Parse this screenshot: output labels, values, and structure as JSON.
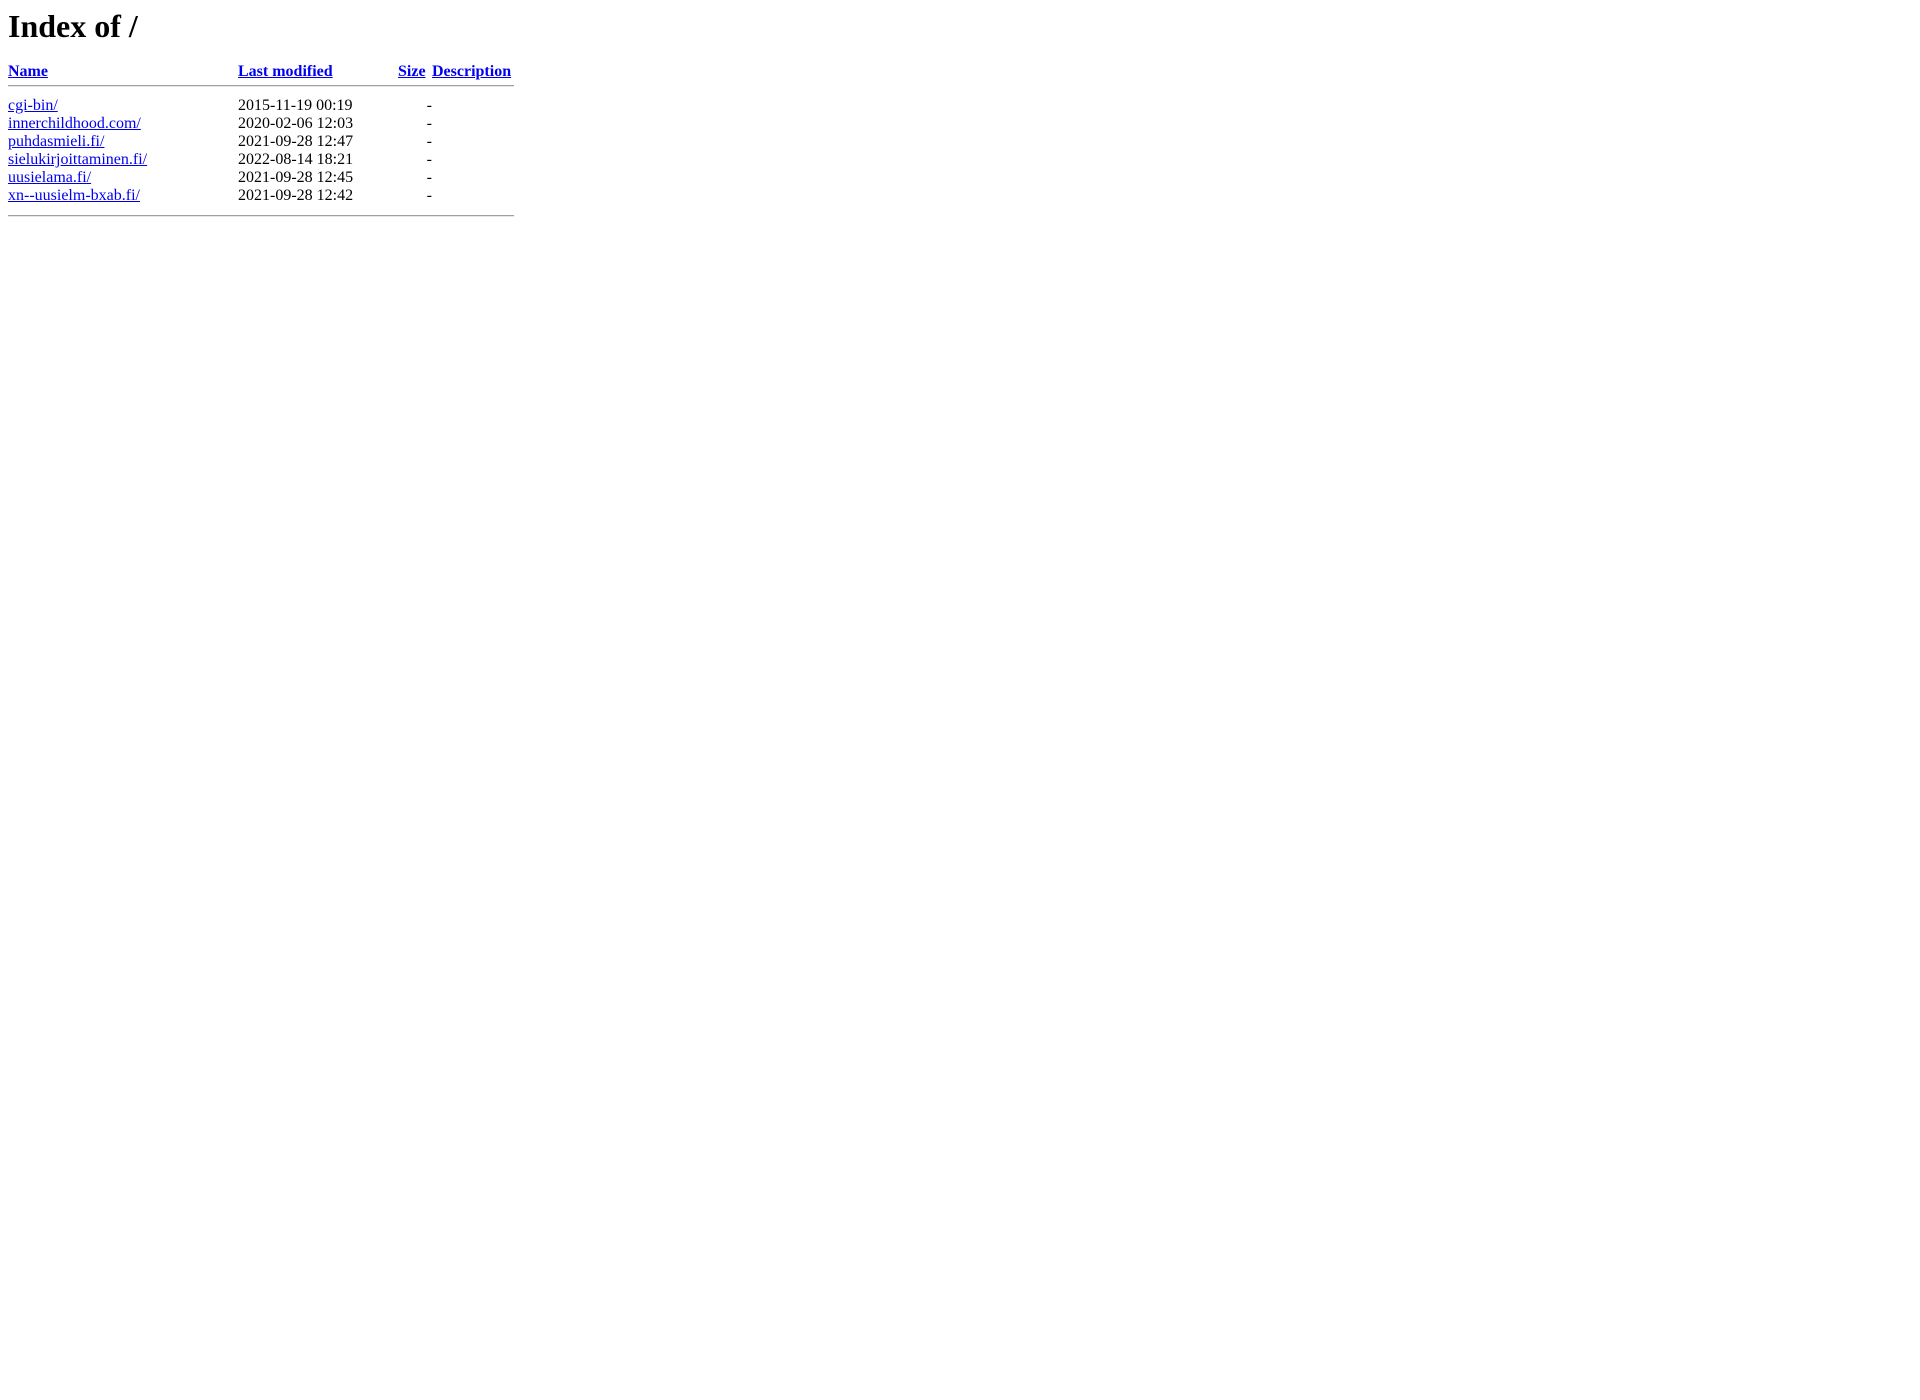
{
  "page": {
    "title": "Index of /",
    "document_title": "Index of /"
  },
  "table": {
    "headers": [
      {
        "label": "Name",
        "name": "sort-by-name"
      },
      {
        "label": "Last modified",
        "name": "sort-by-last-modified"
      },
      {
        "label": "Size",
        "name": "sort-by-size"
      },
      {
        "label": "Description",
        "name": "sort-by-description"
      }
    ],
    "rows": [
      {
        "name": "cgi-bin/",
        "last_modified": "2015-11-19 00:19",
        "size": "-",
        "description": ""
      },
      {
        "name": "innerchildhood.com/",
        "last_modified": "2020-02-06 12:03",
        "size": "-",
        "description": ""
      },
      {
        "name": "puhdasmieli.fi/",
        "last_modified": "2021-09-28 12:47",
        "size": "-",
        "description": ""
      },
      {
        "name": "sielukirjoittaminen.fi/",
        "last_modified": "2022-08-14 18:21",
        "size": "-",
        "description": ""
      },
      {
        "name": "uusielama.fi/",
        "last_modified": "2021-09-28 12:45",
        "size": "-",
        "description": ""
      },
      {
        "name": "xn--uusielm-bxab.fi/",
        "last_modified": "2021-09-28 12:42",
        "size": "-",
        "description": ""
      }
    ]
  },
  "colors": {
    "link": "#0000ee",
    "text": "#000000",
    "background": "#ffffff",
    "rule": "#a0a0a0"
  }
}
